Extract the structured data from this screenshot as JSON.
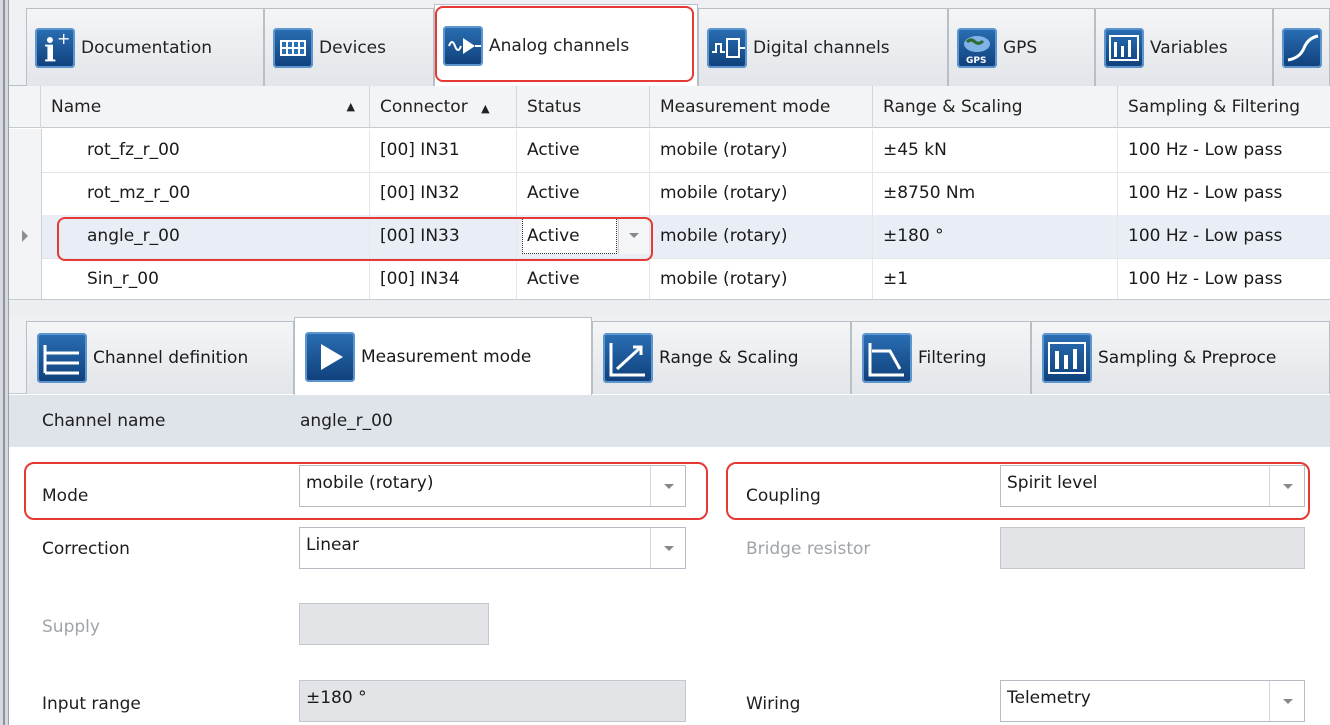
{
  "top_tabs": [
    {
      "label": "Documentation",
      "icon": "info-icon"
    },
    {
      "label": "Devices",
      "icon": "device-grid-icon"
    },
    {
      "label": "Analog channels",
      "icon": "analog-signal-icon"
    },
    {
      "label": "Digital channels",
      "icon": "digital-signal-icon"
    },
    {
      "label": "GPS",
      "icon": "gps-globe-icon",
      "icon_text": "GPS"
    },
    {
      "label": "Variables",
      "icon": "variables-icon"
    }
  ],
  "grid": {
    "headers": {
      "name": "Name",
      "connector": "Connector",
      "status": "Status",
      "mode": "Measurement mode",
      "range": "Range & Scaling",
      "sampling": "Sampling & Filtering"
    },
    "rows": [
      {
        "name": "rot_fz_r_00",
        "connector": "[00] IN31",
        "status": "Active",
        "mode": "mobile (rotary)",
        "range": "±45 kN",
        "sampling": "100 Hz - Low pass"
      },
      {
        "name": "rot_mz_r_00",
        "connector": "[00] IN32",
        "status": "Active",
        "mode": "mobile (rotary)",
        "range": "±8750 Nm",
        "sampling": "100 Hz - Low pass"
      },
      {
        "name": "angle_r_00",
        "connector": "[00] IN33",
        "status": "Active",
        "mode": "mobile (rotary)",
        "range": "±180 °",
        "sampling": "100 Hz - Low pass"
      },
      {
        "name": "Sin_r_00",
        "connector": "[00] IN34",
        "status": "Active",
        "mode": "mobile (rotary)",
        "range": "±1",
        "sampling": "100 Hz - Low pass"
      }
    ]
  },
  "lower_tabs": [
    {
      "label": "Channel definition",
      "icon": "channel-definition-icon"
    },
    {
      "label": "Measurement mode",
      "icon": "play-icon"
    },
    {
      "label": "Range & Scaling",
      "icon": "range-scaling-icon"
    },
    {
      "label": "Filtering",
      "icon": "filter-icon"
    },
    {
      "label": "Sampling & Preproce",
      "icon": "sampling-icon"
    }
  ],
  "form": {
    "channel_name_label": "Channel name",
    "channel_name_value": "angle_r_00",
    "mode_label": "Mode",
    "mode_value": "mobile (rotary)",
    "coupling_label": "Coupling",
    "coupling_value": "Spirit level",
    "correction_label": "Correction",
    "correction_value": "Linear",
    "bridge_resistor_label": "Bridge resistor",
    "supply_label": "Supply",
    "input_range_label": "Input range",
    "input_range_value": "±180 °",
    "wiring_label": "Wiring",
    "wiring_value": "Telemetry"
  },
  "colors": {
    "accent": "#1a4f8f",
    "highlight": "#e53935",
    "selected_row": "#e9eef6"
  }
}
